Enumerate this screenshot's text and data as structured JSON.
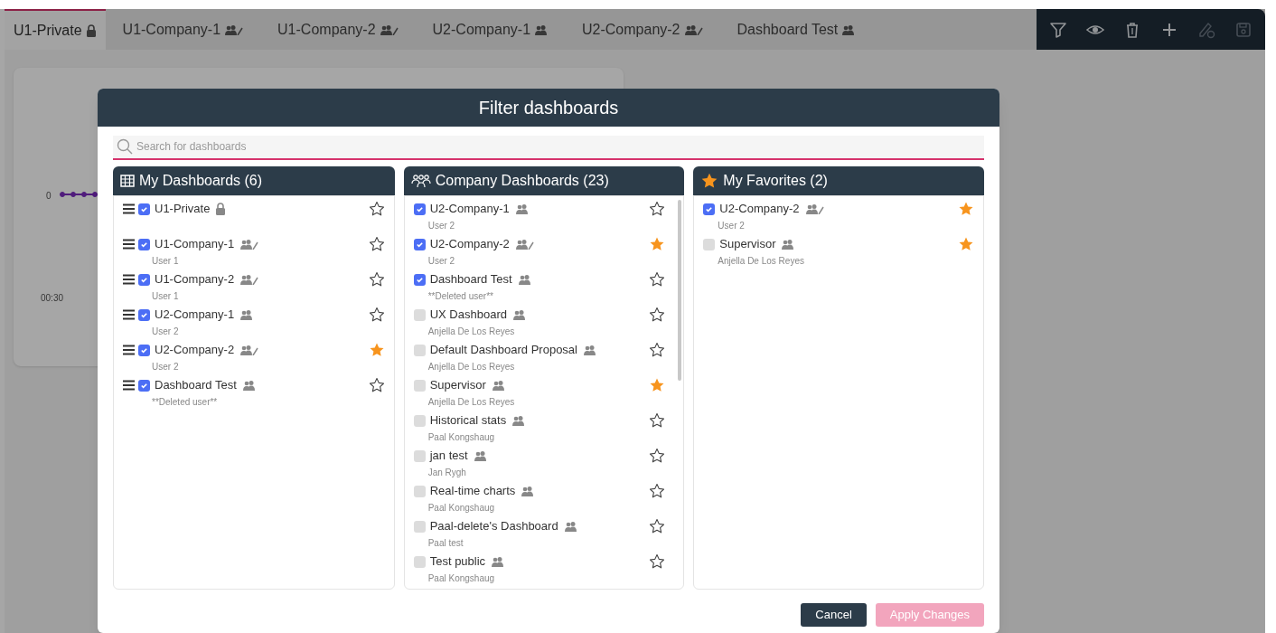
{
  "tabs": [
    {
      "label": "U1-Private",
      "kind": "lock",
      "selected": true
    },
    {
      "label": "U1-Company-1",
      "kind": "group-edit",
      "selected": false
    },
    {
      "label": "U1-Company-2",
      "kind": "group-edit",
      "selected": false
    },
    {
      "label": "U2-Company-1",
      "kind": "group",
      "selected": false
    },
    {
      "label": "U2-Company-2",
      "kind": "group-edit",
      "selected": false
    },
    {
      "label": "Dashboard Test",
      "kind": "group",
      "selected": false
    }
  ],
  "toolbar": [
    {
      "kind": "filter",
      "disabled": false
    },
    {
      "kind": "view",
      "disabled": false
    },
    {
      "kind": "delete",
      "disabled": false
    },
    {
      "kind": "add",
      "disabled": false
    },
    {
      "kind": "edit",
      "disabled": true
    },
    {
      "kind": "save",
      "disabled": true
    }
  ],
  "background_widget": {
    "y_tick": "0",
    "x_tick": "00:30"
  },
  "dialog": {
    "title": "Filter dashboards",
    "search": {
      "placeholder": "Search for dashboards"
    },
    "columns": [
      {
        "kind": "mine",
        "title": "My Dashboards (6)",
        "items": [
          {
            "name": "U1-Private",
            "kind": "lock",
            "checked": true,
            "favorite": false
          },
          {
            "name": "U1-Company-1",
            "kind": "group-edit",
            "owner": "User 1",
            "checked": true,
            "favorite": false
          },
          {
            "name": "U1-Company-2",
            "kind": "group-edit",
            "owner": "User 1",
            "checked": true,
            "favorite": false
          },
          {
            "name": "U2-Company-1",
            "kind": "group",
            "owner": "User 2",
            "checked": true,
            "favorite": false
          },
          {
            "name": "U2-Company-2",
            "kind": "group-edit",
            "owner": "User 2",
            "checked": true,
            "favorite": true
          },
          {
            "name": "Dashboard Test",
            "kind": "group",
            "owner": "**Deleted user**",
            "checked": true,
            "favorite": false
          }
        ]
      },
      {
        "kind": "company",
        "title": "Company Dashboards (23)",
        "items": [
          {
            "name": "U2-Company-1",
            "kind": "group",
            "owner": "User 2",
            "checked": true,
            "favorite": false
          },
          {
            "name": "U2-Company-2",
            "kind": "group-edit",
            "owner": "User 2",
            "checked": true,
            "favorite": true
          },
          {
            "name": "Dashboard Test",
            "kind": "group",
            "owner": "**Deleted user**",
            "checked": true,
            "favorite": false
          },
          {
            "name": "UX Dashboard",
            "kind": "group",
            "owner": "Anjella De Los Reyes",
            "checked": false,
            "favorite": false
          },
          {
            "name": "Default Dashboard Proposal",
            "kind": "group",
            "owner": "Anjella De Los Reyes",
            "checked": false,
            "favorite": false
          },
          {
            "name": "Supervisor",
            "kind": "group",
            "owner": "Anjella De Los Reyes",
            "checked": false,
            "favorite": true
          },
          {
            "name": "Historical stats",
            "kind": "group",
            "owner": "Paal Kongshaug",
            "checked": false,
            "favorite": false
          },
          {
            "name": "jan test",
            "kind": "group",
            "owner": "Jan Rygh",
            "checked": false,
            "favorite": false
          },
          {
            "name": "Real-time charts",
            "kind": "group",
            "owner": "Paal Kongshaug",
            "checked": false,
            "favorite": false
          },
          {
            "name": "Paal-delete's Dashboard",
            "kind": "group",
            "owner": "Paal test",
            "checked": false,
            "favorite": false
          },
          {
            "name": "Test public",
            "kind": "group",
            "owner": "Paal Kongshaug",
            "checked": false,
            "favorite": false
          }
        ]
      },
      {
        "kind": "favorites",
        "title": "My Favorites (2)",
        "items": [
          {
            "name": "U2-Company-2",
            "kind": "group-edit",
            "owner": "User 2",
            "checked": true,
            "favorite": true
          },
          {
            "name": "Supervisor",
            "kind": "group",
            "owner": "Anjella De Los Reyes",
            "checked": false,
            "favorite": true
          }
        ]
      }
    ],
    "buttons": [
      {
        "kind": "cancel",
        "label": "Cancel"
      },
      {
        "kind": "apply",
        "label": "Apply Changes"
      }
    ]
  }
}
